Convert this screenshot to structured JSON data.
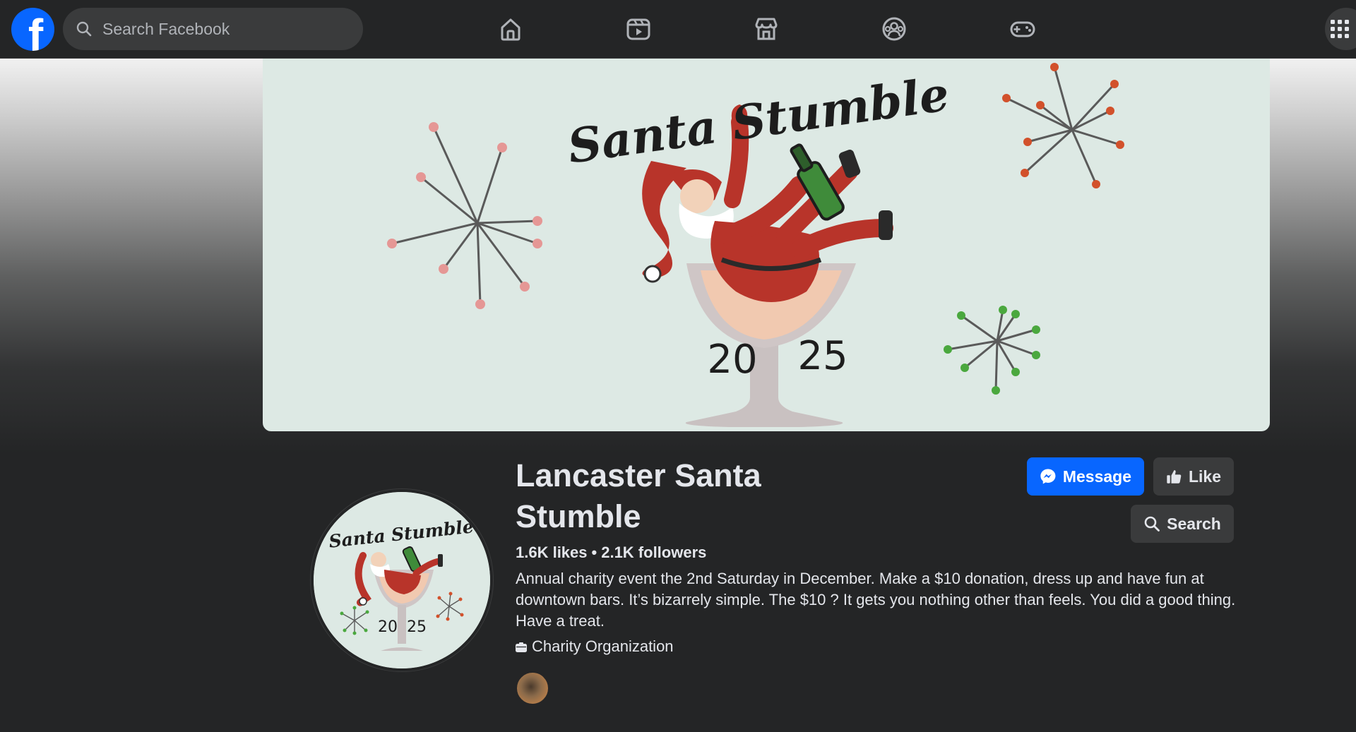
{
  "nav": {
    "logo_letter": "f",
    "search_placeholder": "Search Facebook",
    "icons": [
      "home-icon",
      "reels-icon",
      "marketplace-icon",
      "groups-icon",
      "gaming-icon",
      "menu-grid-icon"
    ]
  },
  "cover": {
    "title_text": "Santa Stumble",
    "year_left": "20",
    "year_right": "25"
  },
  "profile": {
    "name": "Lancaster Santa Stumble",
    "likes": "1.6K likes",
    "separator": "•",
    "followers": "2.1K followers",
    "bio": "Annual charity event the 2nd Saturday in December. Make a $10 donation, dress up and have fun at downtown bars. It’s bizarrely simple. The $10 ? It gets you nothing other than feels. You did a good thing. Have a treat.",
    "category": "Charity Organization",
    "logo_title": "Santa Stumble",
    "logo_year_left": "20",
    "logo_year_right": "25"
  },
  "actions": {
    "message_label": "Message",
    "like_label": "Like",
    "search_label": "Search"
  },
  "colors": {
    "background": "#242526",
    "surface": "#3a3b3c",
    "primary_blue": "#0866ff",
    "text_primary": "#e4e6eb",
    "text_secondary": "#b0b3b8",
    "cover_bg": "#dde9e4"
  }
}
